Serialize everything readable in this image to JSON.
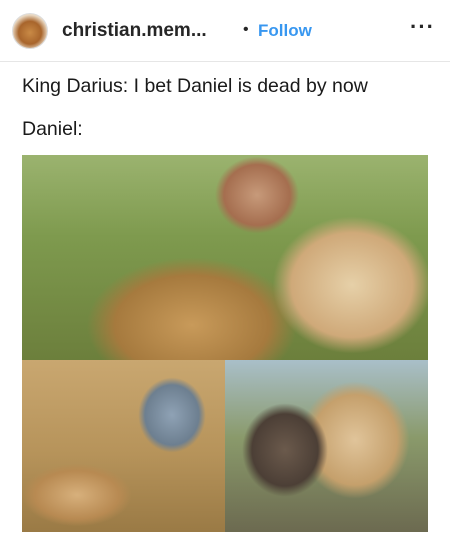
{
  "post": {
    "username": "christian.mem...",
    "follow_label": "Follow",
    "separator": "•",
    "more": "···"
  },
  "caption": {
    "line1": "King Darius: I bet Daniel is dead by now",
    "line2": "Daniel:"
  }
}
